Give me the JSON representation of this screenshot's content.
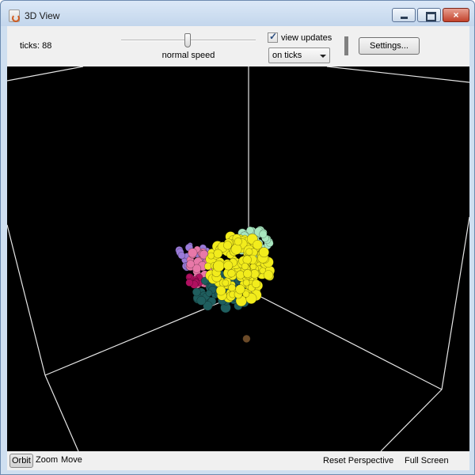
{
  "window": {
    "title": "3D View",
    "app_icon": "java-cup-icon",
    "close_glyph": "×"
  },
  "toolbar": {
    "ticks_label": "ticks: 88",
    "speed_label": "normal speed",
    "speed_slider_level": 0.5,
    "view_updates_checked": true,
    "view_updates_label": "view updates",
    "update_mode_value": "on ticks",
    "settings_label": "Settings..."
  },
  "bottom_bar": {
    "orbit_label": "Orbit",
    "zoom_label": "Zoom",
    "move_label": "Move",
    "active_mode": "Orbit",
    "reset_label": "Reset Perspective",
    "fullscreen_label": "Full Screen"
  },
  "colors": {
    "viewport_background": "#000000",
    "box_lines": "#e6e6e6",
    "yellow_agents": "#f2ec1c",
    "teal_agents": "#1f5e5e",
    "mint_agents": "#a8e6bf",
    "pink_agents": "#e878a8",
    "magenta_agents": "#b01060",
    "purple_agents": "#9a7ad8",
    "brown_agents": "#6b4a28"
  }
}
